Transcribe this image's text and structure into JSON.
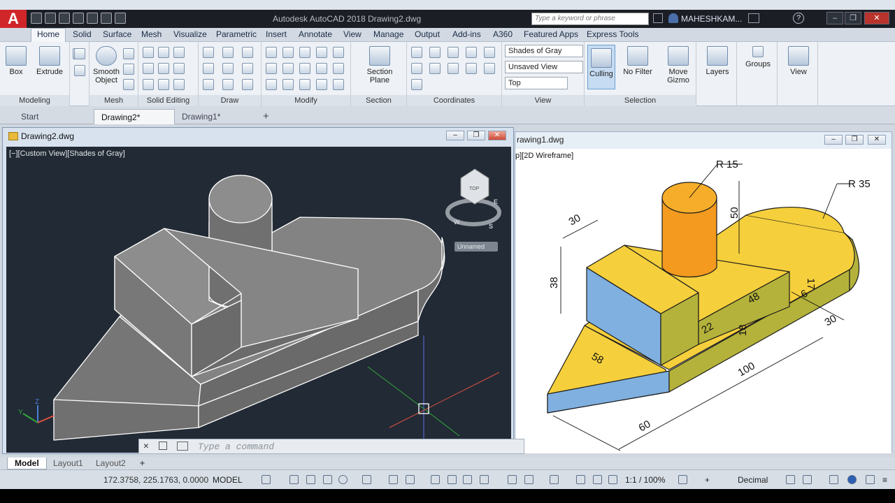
{
  "app": {
    "title": "Autodesk AutoCAD 2018   Drawing2.dwg",
    "search_placeholder": "Type a keyword or phrase",
    "user": "MAHESHKAM..."
  },
  "ribbon_tabs": [
    "Home",
    "Solid",
    "Surface",
    "Mesh",
    "Visualize",
    "Parametric",
    "Insert",
    "Annotate",
    "View",
    "Manage",
    "Output",
    "Add-ins",
    "A360",
    "Featured Apps",
    "Express Tools"
  ],
  "ribbon": {
    "box": "Box",
    "extrude": "Extrude",
    "smooth_object_1": "Smooth",
    "smooth_object_2": "Object",
    "section_plane_1": "Section",
    "section_plane_2": "Plane",
    "visual_style": "Shades of Gray",
    "named_view": "Unsaved View",
    "view_direction": "Top",
    "culling": "Culling",
    "no_filter": "No Filter",
    "move_gizmo_1": "Move",
    "move_gizmo_2": "Gizmo",
    "layers": "Layers",
    "groups": "Groups",
    "view": "View",
    "panels": {
      "modeling": "Modeling",
      "mesh": "Mesh",
      "solid_editing": "Solid Editing",
      "draw": "Draw",
      "modify": "Modify",
      "section": "Section",
      "coordinates": "Coordinates",
      "view": "View",
      "selection": "Selection"
    }
  },
  "file_tabs": [
    "Start",
    "Drawing2*",
    "Drawing1*"
  ],
  "viewport_a": {
    "title": "Drawing2.dwg",
    "label": "[−][Custom View][Shades of Gray]",
    "viewcube_unnamed": "Unnamed",
    "compass": [
      "W",
      "S",
      "E"
    ]
  },
  "viewport_b": {
    "title": "rawing1.dwg",
    "label": "p][2D Wireframe]",
    "dims": [
      "R 15",
      "R 35",
      "30",
      "38",
      "50",
      "48",
      "22",
      "18",
      "17",
      "6",
      "58",
      "100",
      "30",
      "60"
    ]
  },
  "command_placeholder": "Type a command",
  "layout_tabs": [
    "Model",
    "Layout1",
    "Layout2"
  ],
  "status": {
    "coords": "172.3758, 225.1763, 0.0000",
    "space": "MODEL",
    "scale": "1:1 / 100%",
    "units": "Decimal"
  },
  "colors": {
    "yellow_face": "#f5cf3c",
    "olive_face": "#b4b23a",
    "blue_face": "#7fb0e0",
    "orange": "#f39a1f",
    "viewport_bg": "#222a35"
  }
}
